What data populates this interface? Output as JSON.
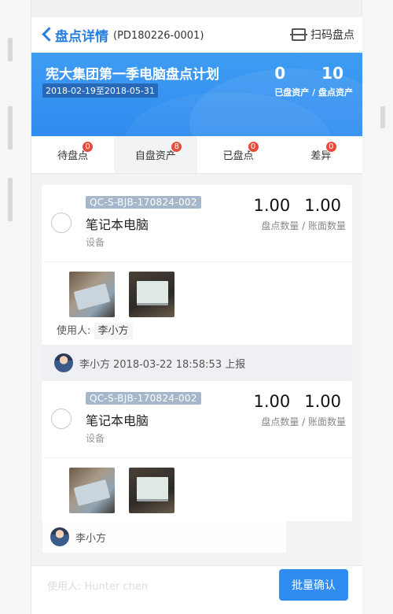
{
  "header": {
    "title": "盘点详情",
    "code": "(PD180226-0001)",
    "scan_label": "扫码盘点"
  },
  "banner": {
    "plan_name": "宪大集团第一季电脑盘点计划",
    "dates": "2018-02-19至2018-05-31",
    "counted": "0",
    "total": "10",
    "stat_label": "已盘资产 / 盘点资产"
  },
  "tabs": [
    {
      "label": "待盘点",
      "badge": "0"
    },
    {
      "label": "自盘资产",
      "badge": "8"
    },
    {
      "label": "已盘点",
      "badge": "0"
    },
    {
      "label": "差异",
      "badge": "0"
    }
  ],
  "items": [
    {
      "code": "QC-S-BJB-170824-002",
      "name": "笔记本电脑",
      "category": "设备",
      "qty_count": "1.00",
      "qty_book": "1.00",
      "qty_label": "盘点数量 / 账面数量",
      "user_label": "使用人:",
      "user": "李小方",
      "report_name": "李小方",
      "report_text": "2018-03-22 18:58:53 上报"
    },
    {
      "code": "QC-S-BJB-170824-002",
      "name": "笔记本电脑",
      "category": "设备",
      "qty_count": "1.00",
      "qty_book": "1.00",
      "qty_label": "盘点数量 / 账面数量"
    }
  ],
  "overlay": {
    "report_name": "李小方"
  },
  "bottom": {
    "ghost_text": "使用人: Hunter chen",
    "batch_label": "批量确认"
  },
  "colors": {
    "accent": "#2f8cf0",
    "badge": "#e84b3c",
    "tag": "#a6b7cc"
  }
}
